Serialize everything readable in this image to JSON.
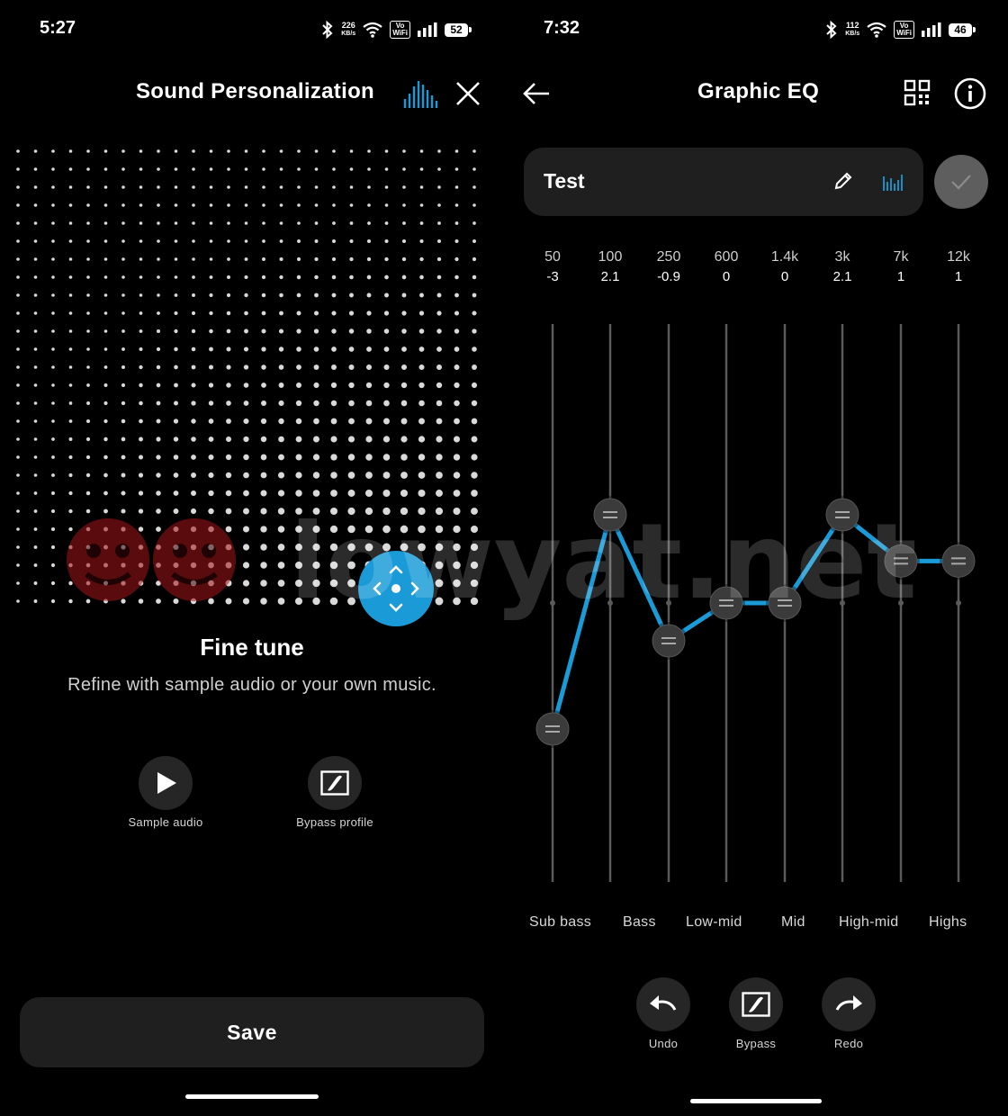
{
  "left": {
    "status": {
      "time": "5:27",
      "speed_value": "226",
      "speed_unit": "KB/s",
      "volte_top": "Vo",
      "volte_bottom": "WiFi",
      "battery": "52"
    },
    "header": {
      "title": "Sound Personalization",
      "icons": [
        "equalizer-icon",
        "close-icon"
      ]
    },
    "fine_tune": {
      "title": "Fine tune",
      "subtitle": "Refine with sample audio or your own music."
    },
    "actions": [
      {
        "label": "Sample audio",
        "icon": "play-icon"
      },
      {
        "label": "Bypass profile",
        "icon": "bypass-icon"
      }
    ],
    "save_label": "Save"
  },
  "right": {
    "status": {
      "time": "7:32",
      "speed_value": "112",
      "speed_unit": "KB/s",
      "volte_top": "Vo",
      "volte_bottom": "WiFi",
      "battery": "46"
    },
    "header": {
      "title": "Graphic EQ",
      "icons": [
        "back-arrow-icon",
        "qr-code-icon",
        "info-icon"
      ]
    },
    "preset": {
      "name": "Test",
      "icons": [
        "pencil-icon",
        "equalizer-icon",
        "check-icon"
      ]
    },
    "band_names": [
      "Sub bass",
      "Bass",
      "Low-mid",
      "Mid",
      "High-mid",
      "Highs"
    ],
    "controls": [
      {
        "label": "Undo",
        "icon": "undo-icon"
      },
      {
        "label": "Bypass",
        "icon": "bypass-icon"
      },
      {
        "label": "Redo",
        "icon": "redo-icon"
      }
    ]
  },
  "chart_data": {
    "type": "line",
    "x": [
      "50",
      "100",
      "250",
      "600",
      "1.4k",
      "3k",
      "7k",
      "12k"
    ],
    "value_labels": [
      "-3",
      "2.1",
      "-0.9",
      "0",
      "0",
      "2.1",
      "1",
      "1"
    ],
    "values": [
      -3,
      2.1,
      -0.9,
      0,
      0,
      2.1,
      1,
      1
    ],
    "ylim": [
      -6,
      6
    ],
    "colors": {
      "line": "#1a9ad6",
      "track": "#5a5a5a",
      "knob": "#3b3b3b"
    }
  },
  "colors": {
    "accent": "#1a9ad6",
    "background": "#000000",
    "surface": "#1f1f1f"
  },
  "watermark": "lowyat.net"
}
